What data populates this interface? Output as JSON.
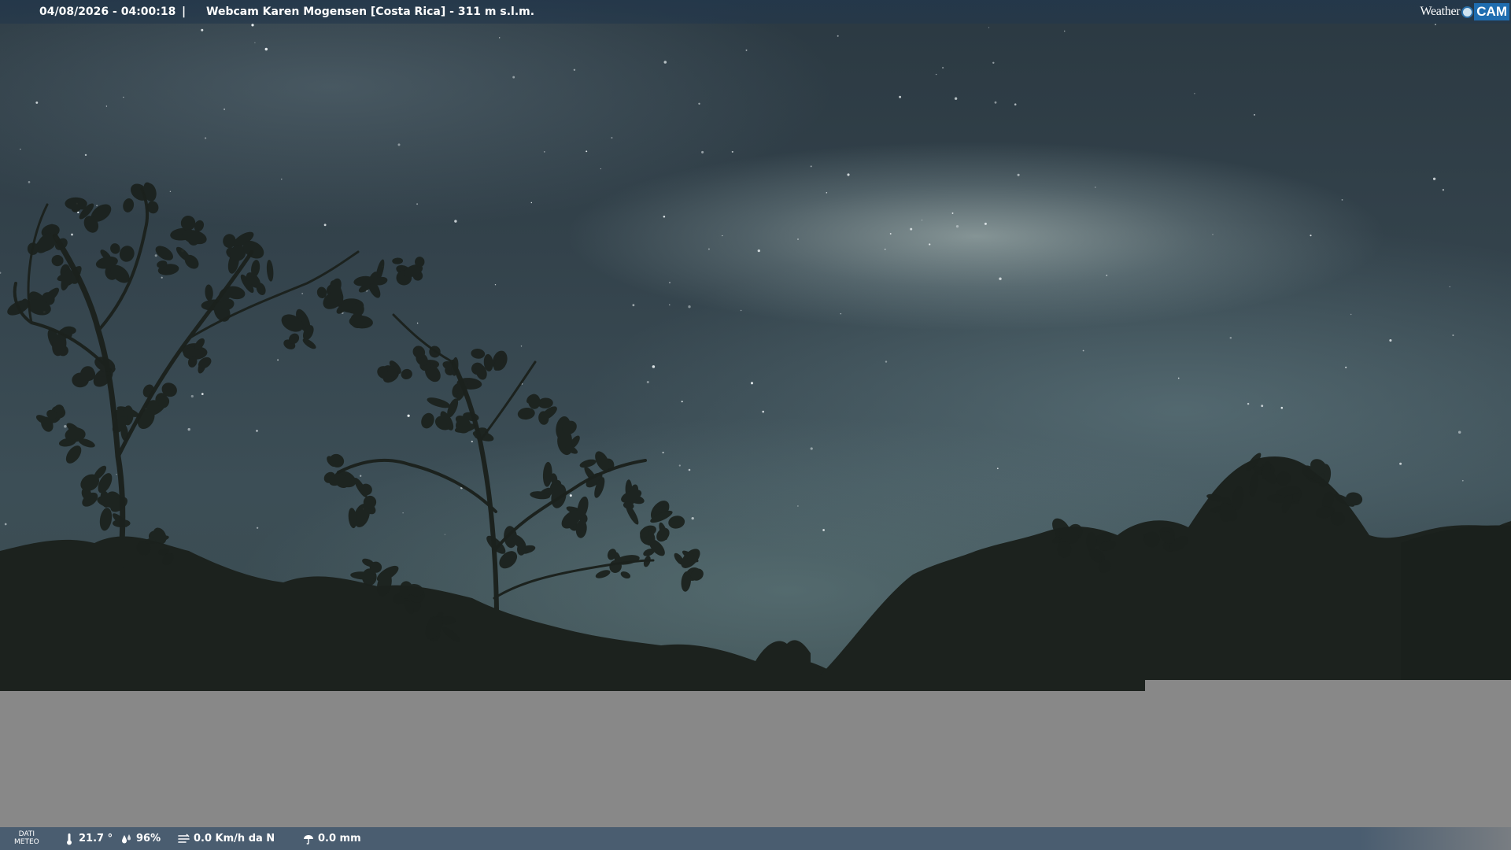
{
  "header": {
    "timestamp": "04/08/2026 - 04:00:18",
    "separator": "|",
    "title": "Webcam Karen Mogensen [Costa Rica]  - 311 m s.l.m.",
    "logo": {
      "weather": "Weather",
      "cam": "CAM",
      "accent": "#1f6db0"
    }
  },
  "scene": {
    "description_icons": [
      "night-sky",
      "trees-silhouette"
    ],
    "sky_color": "#33424b",
    "foliage_color": "#1c221e"
  },
  "meteo": {
    "label_line1": "DATI",
    "label_line2": "METEO",
    "temperature": "21.7 °",
    "humidity": "96%",
    "wind": "0.0 Km/h da N",
    "rain": "0.0 mm",
    "icons": [
      "thermometer-icon",
      "humidity-icon",
      "wind-icon",
      "rain-icon"
    ]
  }
}
